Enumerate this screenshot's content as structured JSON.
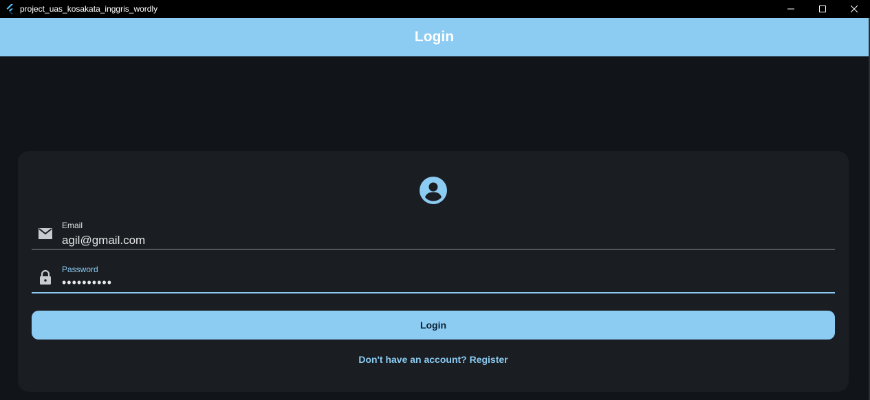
{
  "window": {
    "title": "project_uas_kosakata_inggris_wordly",
    "controls": [
      "minimize-icon",
      "maximize-icon",
      "close-icon"
    ]
  },
  "appbar": {
    "title": "Login"
  },
  "form": {
    "avatar_icon": "account-circle-icon",
    "email": {
      "label": "Email",
      "value": "agil@gmail.com",
      "icon": "mail-icon"
    },
    "password": {
      "label": "Password",
      "value": "••••••••••",
      "icon": "lock-icon"
    },
    "login_button": "Login",
    "register_link": "Don't have an account? Register"
  },
  "colors": {
    "accent": "#8ccbf2",
    "background": "#11151a",
    "card": "#1a1e23"
  }
}
